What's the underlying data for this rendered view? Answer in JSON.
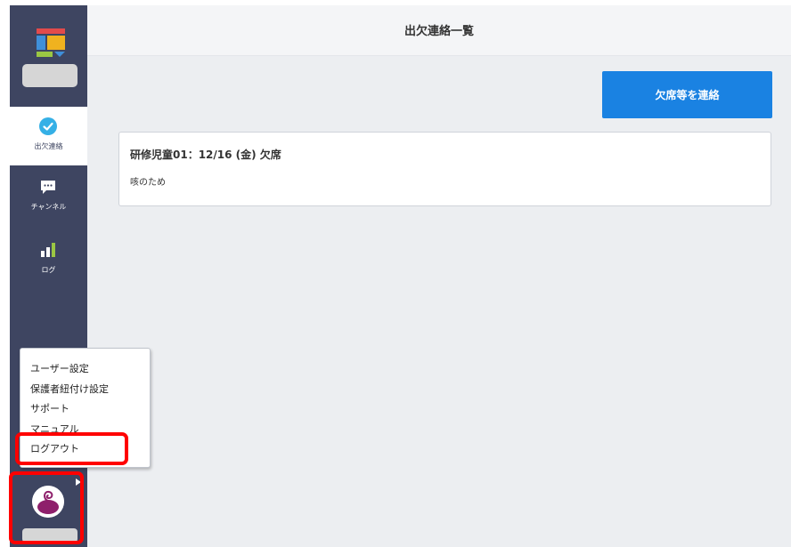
{
  "header": {
    "title": "出欠連絡一覧"
  },
  "sidebar": {
    "logo_icon": "school-logo-icon",
    "items": [
      {
        "label": "出欠連絡",
        "icon": "check-circle-icon",
        "active": true
      },
      {
        "label": "チャンネル",
        "icon": "chat-bubble-icon",
        "active": false
      },
      {
        "label": "ログ",
        "icon": "bar-chart-icon",
        "active": false
      }
    ]
  },
  "main": {
    "contact_button_label": "欠席等を連絡",
    "absence_list": [
      {
        "title": "研修児童01：12/16 (金) 欠席",
        "reason": "咳のため"
      }
    ]
  },
  "user_menu": {
    "items": [
      {
        "label": "ユーザー設定"
      },
      {
        "label": "保護者紐付け設定"
      },
      {
        "label": "サポート"
      },
      {
        "label": "マニュアル"
      },
      {
        "label": "ログアウト"
      }
    ]
  },
  "colors": {
    "sidebar": "#3e4561",
    "accent": "#1a82e2",
    "highlight": "#ff0000",
    "check": "#35b0e6"
  }
}
